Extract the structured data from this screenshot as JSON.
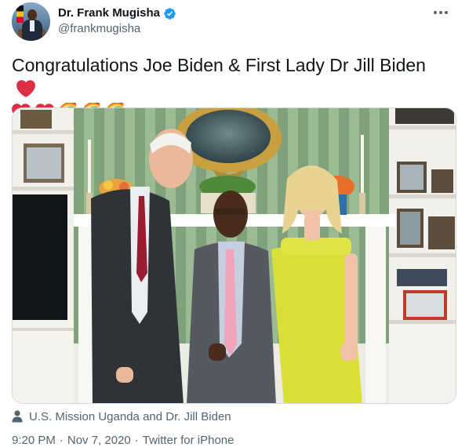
{
  "author": {
    "display_name": "Dr. Frank Mugisha",
    "handle": "@frankmugisha",
    "verified": true,
    "icons": {
      "verified": "verified-badge-icon",
      "more": "more-options-icon",
      "avatar": "profile-avatar"
    }
  },
  "tweet": {
    "text": "Congratulations Joe Biden & First Lady Dr Jill Biden",
    "emojis": [
      "red-heart",
      "red-heart",
      "red-heart",
      "rainbow",
      "rainbow",
      "rainbow"
    ]
  },
  "media": {
    "type": "photo",
    "tag_icon": "person-tag-icon",
    "tagged_people": "U.S. Mission Uganda and Dr. Jill Biden"
  },
  "meta": {
    "time": "9:20 PM",
    "date": "Nov 7, 2020",
    "source": "Twitter for iPhone",
    "separator": "·"
  },
  "colors": {
    "text_primary": "#0f1419",
    "text_secondary": "#536471",
    "verified_blue": "#1d9bf0",
    "heart_red": "#e0245e",
    "border": "#cfd9de"
  }
}
